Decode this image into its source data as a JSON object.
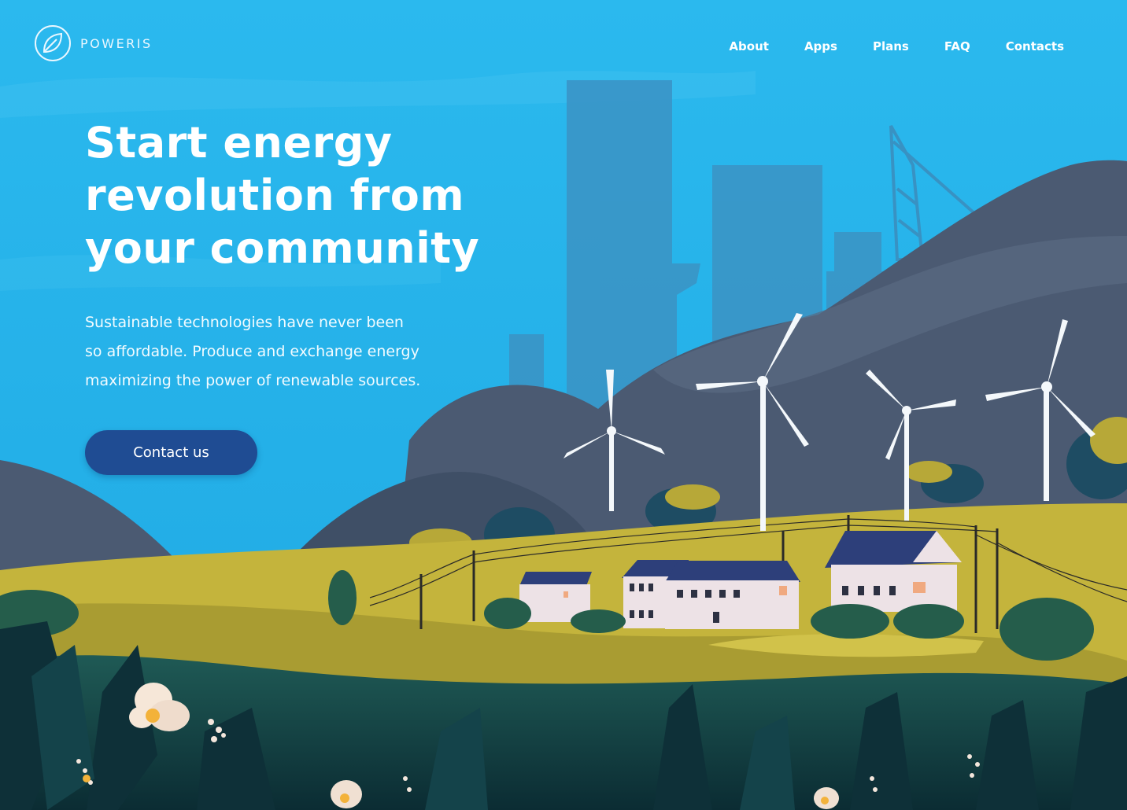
{
  "brand": {
    "name": "POWERIS",
    "logo_icon": "leaf-in-circle-icon"
  },
  "nav": {
    "items": [
      {
        "label": "About"
      },
      {
        "label": "Apps"
      },
      {
        "label": "Plans"
      },
      {
        "label": "FAQ"
      },
      {
        "label": "Contacts"
      }
    ]
  },
  "hero": {
    "title_lines": [
      "Start energy",
      "revolution from",
      "your community"
    ],
    "subtitle_lines": [
      "Sustainable technologies have never been",
      "so affordable. Produce and exchange energy",
      "maximizing the power of renewable sources."
    ],
    "cta_label": "Contact us"
  },
  "colors": {
    "sky": "#27b4ea",
    "cta_background": "#1f4c93",
    "hills": "#4c5b72",
    "meadow": "#c8b73e",
    "foreground": "#0f3a3e"
  }
}
